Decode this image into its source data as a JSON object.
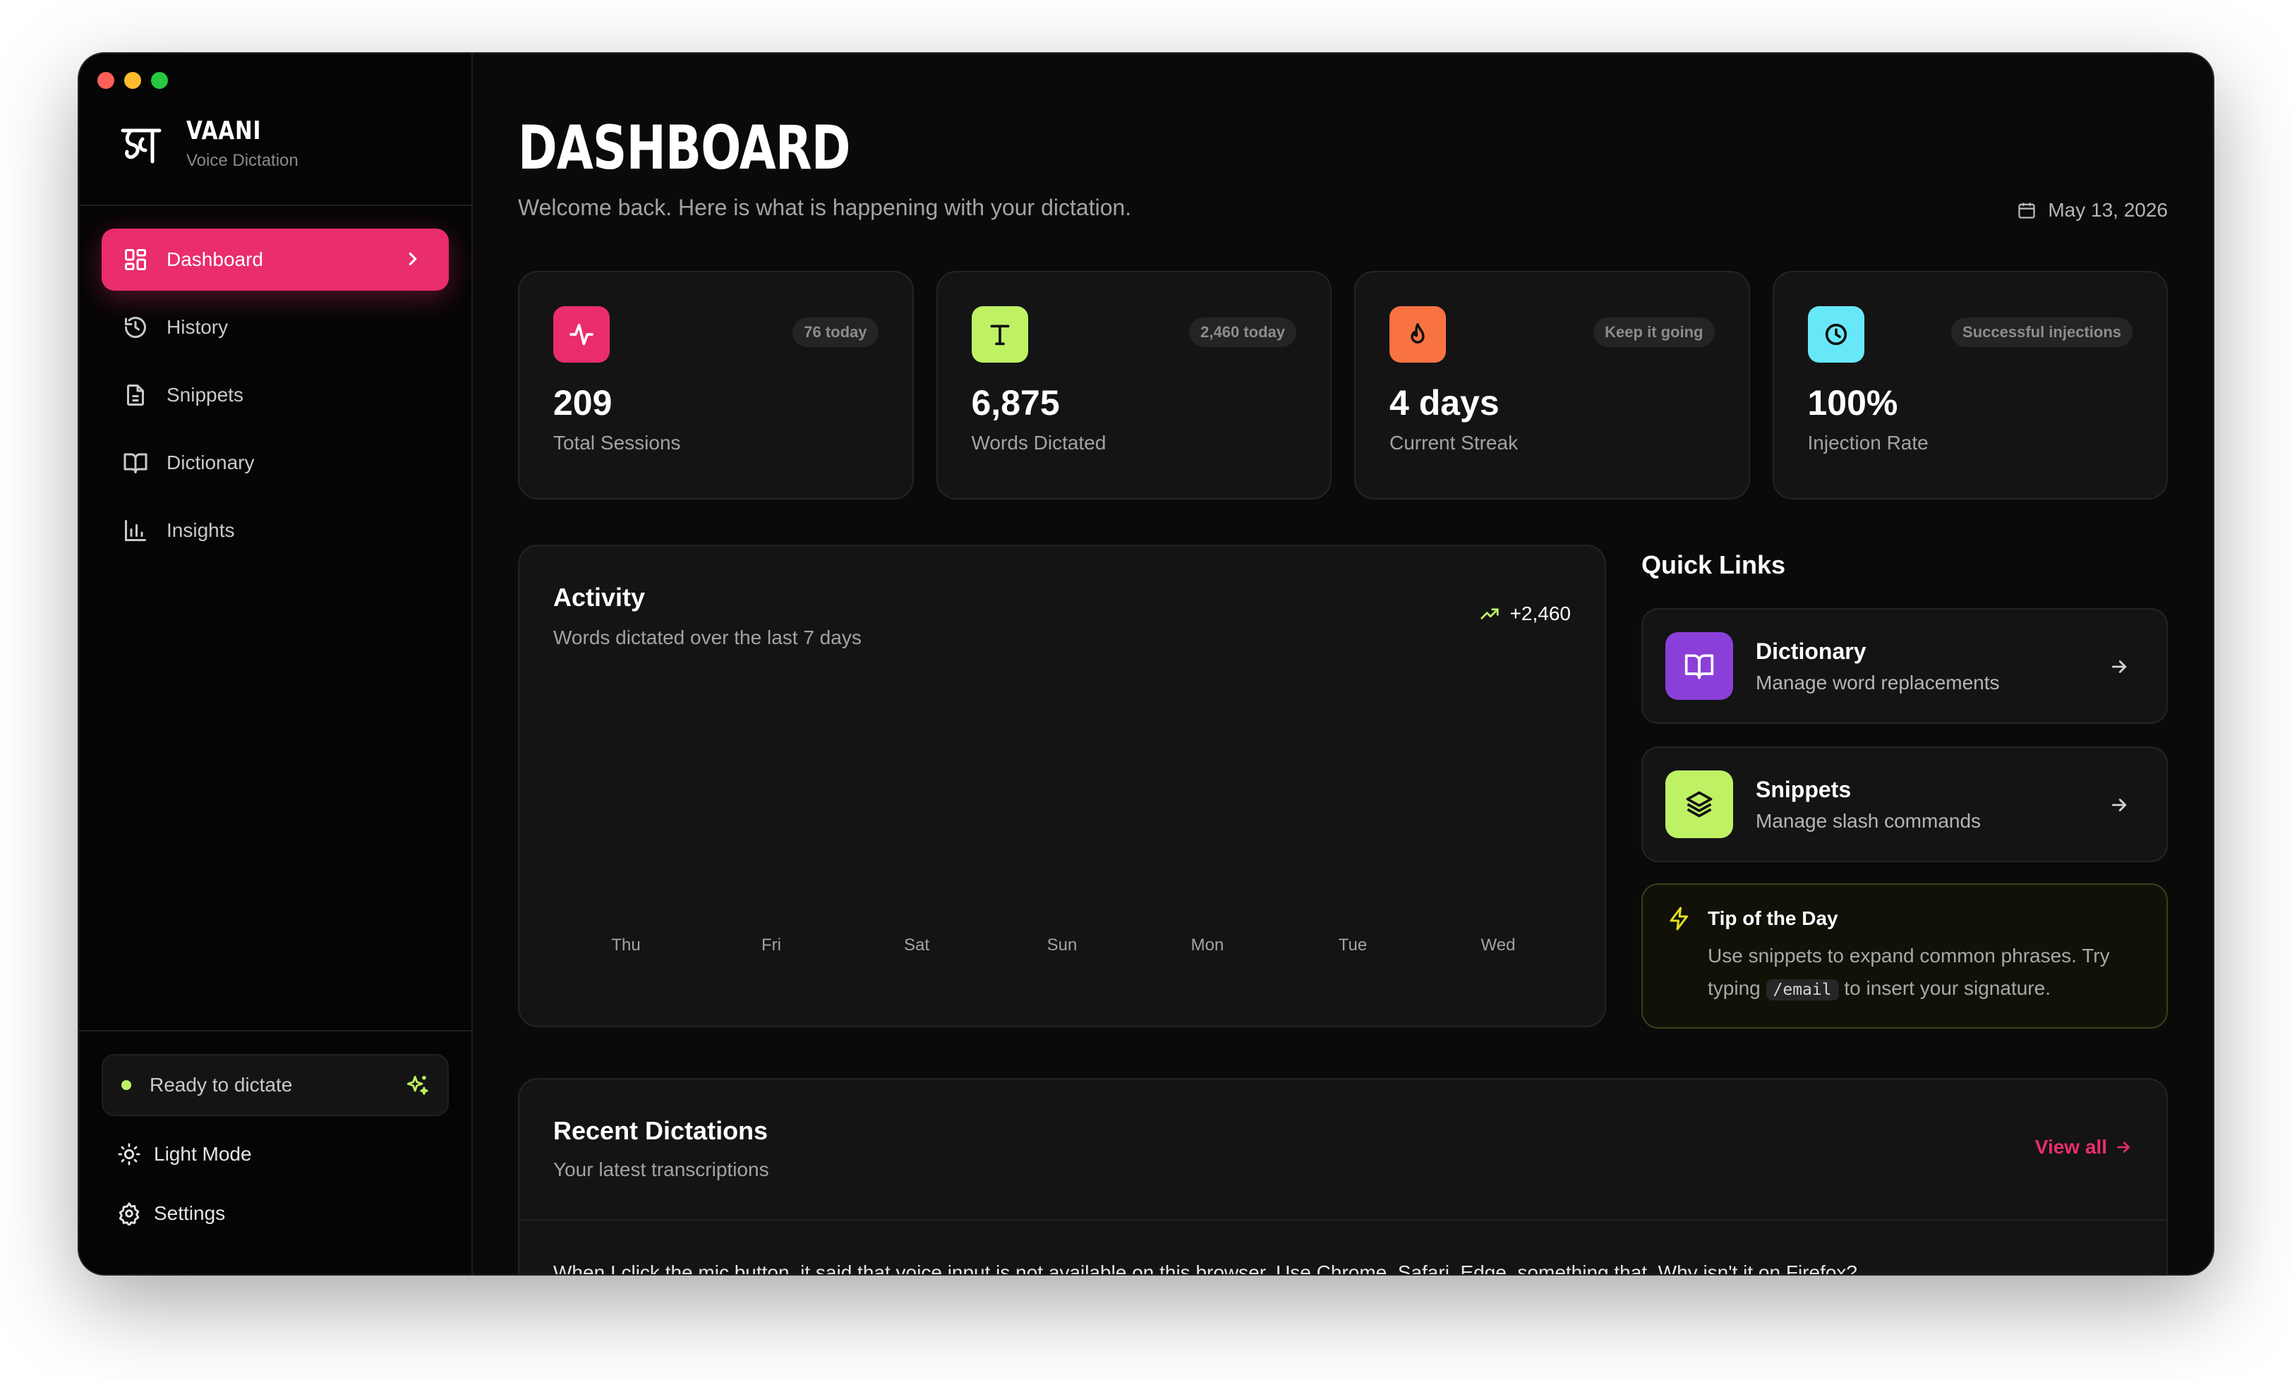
{
  "colors": {
    "accent": "#ea2d6b",
    "sessions_icon_bg": "#ea2d6b",
    "words_icon_bg": "#bef264",
    "streak_icon_bg": "#f97341",
    "injection_icon_bg": "#67e8f9",
    "dictionary_icon_bg": "#8b3fd9",
    "snippets_icon_bg": "#bef264",
    "status_dot": "#bef264"
  },
  "brand": {
    "name": "VAANI",
    "subtitle": "Voice Dictation"
  },
  "sidebar": {
    "items": [
      {
        "label": "Dashboard",
        "icon": "grid-icon",
        "active": true
      },
      {
        "label": "History",
        "icon": "history-icon"
      },
      {
        "label": "Snippets",
        "icon": "document-icon"
      },
      {
        "label": "Dictionary",
        "icon": "book-icon"
      },
      {
        "label": "Insights",
        "icon": "bar-chart-icon"
      }
    ],
    "status": "Ready to dictate",
    "light_mode": "Light Mode",
    "settings": "Settings"
  },
  "header": {
    "title": "DASHBOARD",
    "subtitle": "Welcome back. Here is what is happening with your dictation.",
    "date": "May 13, 2026"
  },
  "stats": [
    {
      "value": "209",
      "label": "Total Sessions",
      "badge": "76 today",
      "icon": "activity-icon"
    },
    {
      "value": "6,875",
      "label": "Words Dictated",
      "badge": "2,460 today",
      "icon": "text-icon"
    },
    {
      "value": "4 days",
      "label": "Current Streak",
      "badge": "Keep it going",
      "icon": "flame-icon"
    },
    {
      "value": "100%",
      "label": "Injection Rate",
      "badge": "Successful injections",
      "icon": "clock-icon"
    }
  ],
  "activity": {
    "title": "Activity",
    "subtitle": "Words dictated over the last 7 days",
    "trend": "+2,460",
    "days": [
      "Thu",
      "Fri",
      "Sat",
      "Sun",
      "Mon",
      "Tue",
      "Wed"
    ]
  },
  "quick_links": {
    "title": "Quick Links",
    "items": [
      {
        "title": "Dictionary",
        "subtitle": "Manage word replacements",
        "icon": "book-icon"
      },
      {
        "title": "Snippets",
        "subtitle": "Manage slash commands",
        "icon": "layers-icon"
      }
    ]
  },
  "tip": {
    "title": "Tip of the Day",
    "text_before": "Use snippets to expand common phrases. Try typing",
    "code": "/email",
    "text_after": "to insert your signature."
  },
  "recent": {
    "title": "Recent Dictations",
    "subtitle": "Your latest transcriptions",
    "view_all": "View all",
    "rows": [
      "When I click the mic button, it said that voice input is not available on this browser. Use Chrome, Safari, Edge, something that. Why isn't it on Firefox?"
    ]
  }
}
